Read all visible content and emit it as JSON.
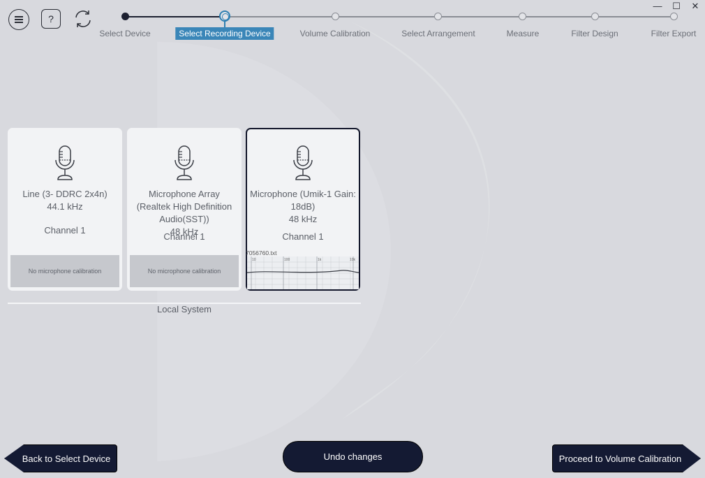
{
  "window": {
    "minimize_glyph": "—",
    "maximize_glyph": "☐",
    "close_glyph": "✕"
  },
  "toolbar": {
    "menu_icon": "hamburger-menu-icon",
    "help_label": "?",
    "refresh_icon": "refresh-icon"
  },
  "stepper": {
    "steps": [
      {
        "label": "Select Device",
        "state": "done"
      },
      {
        "label": "Select Recording Device",
        "state": "active"
      },
      {
        "label": "Volume Calibration",
        "state": "pending"
      },
      {
        "label": "Select Arrangement",
        "state": "pending"
      },
      {
        "label": "Measure",
        "state": "pending"
      },
      {
        "label": "Filter Design",
        "state": "pending"
      },
      {
        "label": "Filter Export",
        "state": "pending"
      }
    ]
  },
  "devices": [
    {
      "name": "Line (3- DDRC 2x4n)",
      "rate": "44.1 kHz",
      "channel": "Channel 1",
      "calibration": "No microphone calibration",
      "selected": false
    },
    {
      "name": "Microphone Array (Realtek High Definition Audio(SST))",
      "rate": "48 kHz",
      "channel": "Channel 1",
      "calibration": "No microphone calibration",
      "selected": false
    },
    {
      "name": "Microphone (Umik-1  Gain: 18dB)",
      "rate": "48 kHz",
      "channel": "Channel 1",
      "calibration_file": "7056760.txt",
      "calibration_graph_labels": [
        "10",
        "100",
        "1k",
        "10k"
      ],
      "selected": true
    }
  ],
  "group": {
    "label": "Local System"
  },
  "buttons": {
    "back": "Back to Select Device",
    "undo": "Undo changes",
    "proceed": "Proceed to Volume Calibration"
  },
  "colors": {
    "background": "#d8d9de",
    "card": "#f2f3f5",
    "button": "#141a33",
    "active_step": "#3a86b8"
  }
}
